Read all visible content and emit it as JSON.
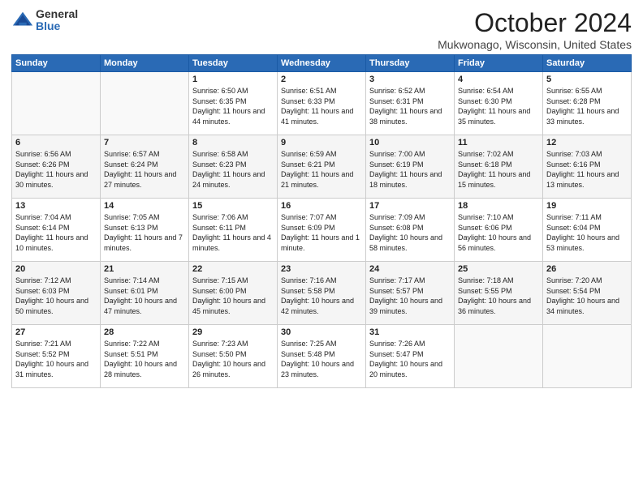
{
  "header": {
    "logo_general": "General",
    "logo_blue": "Blue",
    "title": "October 2024",
    "location": "Mukwonago, Wisconsin, United States"
  },
  "days_of_week": [
    "Sunday",
    "Monday",
    "Tuesday",
    "Wednesday",
    "Thursday",
    "Friday",
    "Saturday"
  ],
  "weeks": [
    [
      {
        "day": "",
        "content": ""
      },
      {
        "day": "",
        "content": ""
      },
      {
        "day": "1",
        "content": "Sunrise: 6:50 AM\nSunset: 6:35 PM\nDaylight: 11 hours\nand 44 minutes."
      },
      {
        "day": "2",
        "content": "Sunrise: 6:51 AM\nSunset: 6:33 PM\nDaylight: 11 hours\nand 41 minutes."
      },
      {
        "day": "3",
        "content": "Sunrise: 6:52 AM\nSunset: 6:31 PM\nDaylight: 11 hours\nand 38 minutes."
      },
      {
        "day": "4",
        "content": "Sunrise: 6:54 AM\nSunset: 6:30 PM\nDaylight: 11 hours\nand 35 minutes."
      },
      {
        "day": "5",
        "content": "Sunrise: 6:55 AM\nSunset: 6:28 PM\nDaylight: 11 hours\nand 33 minutes."
      }
    ],
    [
      {
        "day": "6",
        "content": "Sunrise: 6:56 AM\nSunset: 6:26 PM\nDaylight: 11 hours\nand 30 minutes."
      },
      {
        "day": "7",
        "content": "Sunrise: 6:57 AM\nSunset: 6:24 PM\nDaylight: 11 hours\nand 27 minutes."
      },
      {
        "day": "8",
        "content": "Sunrise: 6:58 AM\nSunset: 6:23 PM\nDaylight: 11 hours\nand 24 minutes."
      },
      {
        "day": "9",
        "content": "Sunrise: 6:59 AM\nSunset: 6:21 PM\nDaylight: 11 hours\nand 21 minutes."
      },
      {
        "day": "10",
        "content": "Sunrise: 7:00 AM\nSunset: 6:19 PM\nDaylight: 11 hours\nand 18 minutes."
      },
      {
        "day": "11",
        "content": "Sunrise: 7:02 AM\nSunset: 6:18 PM\nDaylight: 11 hours\nand 15 minutes."
      },
      {
        "day": "12",
        "content": "Sunrise: 7:03 AM\nSunset: 6:16 PM\nDaylight: 11 hours\nand 13 minutes."
      }
    ],
    [
      {
        "day": "13",
        "content": "Sunrise: 7:04 AM\nSunset: 6:14 PM\nDaylight: 11 hours\nand 10 minutes."
      },
      {
        "day": "14",
        "content": "Sunrise: 7:05 AM\nSunset: 6:13 PM\nDaylight: 11 hours\nand 7 minutes."
      },
      {
        "day": "15",
        "content": "Sunrise: 7:06 AM\nSunset: 6:11 PM\nDaylight: 11 hours\nand 4 minutes."
      },
      {
        "day": "16",
        "content": "Sunrise: 7:07 AM\nSunset: 6:09 PM\nDaylight: 11 hours\nand 1 minute."
      },
      {
        "day": "17",
        "content": "Sunrise: 7:09 AM\nSunset: 6:08 PM\nDaylight: 10 hours\nand 58 minutes."
      },
      {
        "day": "18",
        "content": "Sunrise: 7:10 AM\nSunset: 6:06 PM\nDaylight: 10 hours\nand 56 minutes."
      },
      {
        "day": "19",
        "content": "Sunrise: 7:11 AM\nSunset: 6:04 PM\nDaylight: 10 hours\nand 53 minutes."
      }
    ],
    [
      {
        "day": "20",
        "content": "Sunrise: 7:12 AM\nSunset: 6:03 PM\nDaylight: 10 hours\nand 50 minutes."
      },
      {
        "day": "21",
        "content": "Sunrise: 7:14 AM\nSunset: 6:01 PM\nDaylight: 10 hours\nand 47 minutes."
      },
      {
        "day": "22",
        "content": "Sunrise: 7:15 AM\nSunset: 6:00 PM\nDaylight: 10 hours\nand 45 minutes."
      },
      {
        "day": "23",
        "content": "Sunrise: 7:16 AM\nSunset: 5:58 PM\nDaylight: 10 hours\nand 42 minutes."
      },
      {
        "day": "24",
        "content": "Sunrise: 7:17 AM\nSunset: 5:57 PM\nDaylight: 10 hours\nand 39 minutes."
      },
      {
        "day": "25",
        "content": "Sunrise: 7:18 AM\nSunset: 5:55 PM\nDaylight: 10 hours\nand 36 minutes."
      },
      {
        "day": "26",
        "content": "Sunrise: 7:20 AM\nSunset: 5:54 PM\nDaylight: 10 hours\nand 34 minutes."
      }
    ],
    [
      {
        "day": "27",
        "content": "Sunrise: 7:21 AM\nSunset: 5:52 PM\nDaylight: 10 hours\nand 31 minutes."
      },
      {
        "day": "28",
        "content": "Sunrise: 7:22 AM\nSunset: 5:51 PM\nDaylight: 10 hours\nand 28 minutes."
      },
      {
        "day": "29",
        "content": "Sunrise: 7:23 AM\nSunset: 5:50 PM\nDaylight: 10 hours\nand 26 minutes."
      },
      {
        "day": "30",
        "content": "Sunrise: 7:25 AM\nSunset: 5:48 PM\nDaylight: 10 hours\nand 23 minutes."
      },
      {
        "day": "31",
        "content": "Sunrise: 7:26 AM\nSunset: 5:47 PM\nDaylight: 10 hours\nand 20 minutes."
      },
      {
        "day": "",
        "content": ""
      },
      {
        "day": "",
        "content": ""
      }
    ]
  ]
}
